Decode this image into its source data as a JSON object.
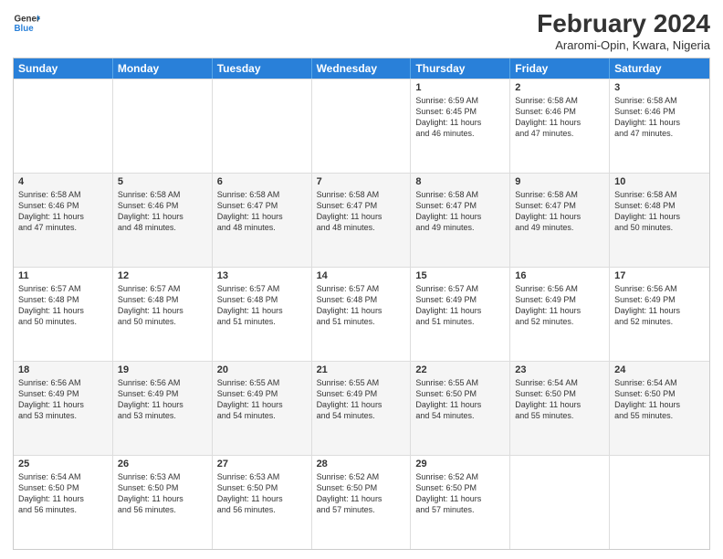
{
  "header": {
    "logo_general": "General",
    "logo_blue": "Blue",
    "month_year": "February 2024",
    "location": "Araromi-Opin, Kwara, Nigeria"
  },
  "days_of_week": [
    "Sunday",
    "Monday",
    "Tuesday",
    "Wednesday",
    "Thursday",
    "Friday",
    "Saturday"
  ],
  "weeks": [
    [
      {
        "day": "",
        "info": ""
      },
      {
        "day": "",
        "info": ""
      },
      {
        "day": "",
        "info": ""
      },
      {
        "day": "",
        "info": ""
      },
      {
        "day": "1",
        "info": "Sunrise: 6:59 AM\nSunset: 6:45 PM\nDaylight: 11 hours\nand 46 minutes."
      },
      {
        "day": "2",
        "info": "Sunrise: 6:58 AM\nSunset: 6:46 PM\nDaylight: 11 hours\nand 47 minutes."
      },
      {
        "day": "3",
        "info": "Sunrise: 6:58 AM\nSunset: 6:46 PM\nDaylight: 11 hours\nand 47 minutes."
      }
    ],
    [
      {
        "day": "4",
        "info": "Sunrise: 6:58 AM\nSunset: 6:46 PM\nDaylight: 11 hours\nand 47 minutes."
      },
      {
        "day": "5",
        "info": "Sunrise: 6:58 AM\nSunset: 6:46 PM\nDaylight: 11 hours\nand 48 minutes."
      },
      {
        "day": "6",
        "info": "Sunrise: 6:58 AM\nSunset: 6:47 PM\nDaylight: 11 hours\nand 48 minutes."
      },
      {
        "day": "7",
        "info": "Sunrise: 6:58 AM\nSunset: 6:47 PM\nDaylight: 11 hours\nand 48 minutes."
      },
      {
        "day": "8",
        "info": "Sunrise: 6:58 AM\nSunset: 6:47 PM\nDaylight: 11 hours\nand 49 minutes."
      },
      {
        "day": "9",
        "info": "Sunrise: 6:58 AM\nSunset: 6:47 PM\nDaylight: 11 hours\nand 49 minutes."
      },
      {
        "day": "10",
        "info": "Sunrise: 6:58 AM\nSunset: 6:48 PM\nDaylight: 11 hours\nand 50 minutes."
      }
    ],
    [
      {
        "day": "11",
        "info": "Sunrise: 6:57 AM\nSunset: 6:48 PM\nDaylight: 11 hours\nand 50 minutes."
      },
      {
        "day": "12",
        "info": "Sunrise: 6:57 AM\nSunset: 6:48 PM\nDaylight: 11 hours\nand 50 minutes."
      },
      {
        "day": "13",
        "info": "Sunrise: 6:57 AM\nSunset: 6:48 PM\nDaylight: 11 hours\nand 51 minutes."
      },
      {
        "day": "14",
        "info": "Sunrise: 6:57 AM\nSunset: 6:48 PM\nDaylight: 11 hours\nand 51 minutes."
      },
      {
        "day": "15",
        "info": "Sunrise: 6:57 AM\nSunset: 6:49 PM\nDaylight: 11 hours\nand 51 minutes."
      },
      {
        "day": "16",
        "info": "Sunrise: 6:56 AM\nSunset: 6:49 PM\nDaylight: 11 hours\nand 52 minutes."
      },
      {
        "day": "17",
        "info": "Sunrise: 6:56 AM\nSunset: 6:49 PM\nDaylight: 11 hours\nand 52 minutes."
      }
    ],
    [
      {
        "day": "18",
        "info": "Sunrise: 6:56 AM\nSunset: 6:49 PM\nDaylight: 11 hours\nand 53 minutes."
      },
      {
        "day": "19",
        "info": "Sunrise: 6:56 AM\nSunset: 6:49 PM\nDaylight: 11 hours\nand 53 minutes."
      },
      {
        "day": "20",
        "info": "Sunrise: 6:55 AM\nSunset: 6:49 PM\nDaylight: 11 hours\nand 54 minutes."
      },
      {
        "day": "21",
        "info": "Sunrise: 6:55 AM\nSunset: 6:49 PM\nDaylight: 11 hours\nand 54 minutes."
      },
      {
        "day": "22",
        "info": "Sunrise: 6:55 AM\nSunset: 6:50 PM\nDaylight: 11 hours\nand 54 minutes."
      },
      {
        "day": "23",
        "info": "Sunrise: 6:54 AM\nSunset: 6:50 PM\nDaylight: 11 hours\nand 55 minutes."
      },
      {
        "day": "24",
        "info": "Sunrise: 6:54 AM\nSunset: 6:50 PM\nDaylight: 11 hours\nand 55 minutes."
      }
    ],
    [
      {
        "day": "25",
        "info": "Sunrise: 6:54 AM\nSunset: 6:50 PM\nDaylight: 11 hours\nand 56 minutes."
      },
      {
        "day": "26",
        "info": "Sunrise: 6:53 AM\nSunset: 6:50 PM\nDaylight: 11 hours\nand 56 minutes."
      },
      {
        "day": "27",
        "info": "Sunrise: 6:53 AM\nSunset: 6:50 PM\nDaylight: 11 hours\nand 56 minutes."
      },
      {
        "day": "28",
        "info": "Sunrise: 6:52 AM\nSunset: 6:50 PM\nDaylight: 11 hours\nand 57 minutes."
      },
      {
        "day": "29",
        "info": "Sunrise: 6:52 AM\nSunset: 6:50 PM\nDaylight: 11 hours\nand 57 minutes."
      },
      {
        "day": "",
        "info": ""
      },
      {
        "day": "",
        "info": ""
      }
    ]
  ]
}
